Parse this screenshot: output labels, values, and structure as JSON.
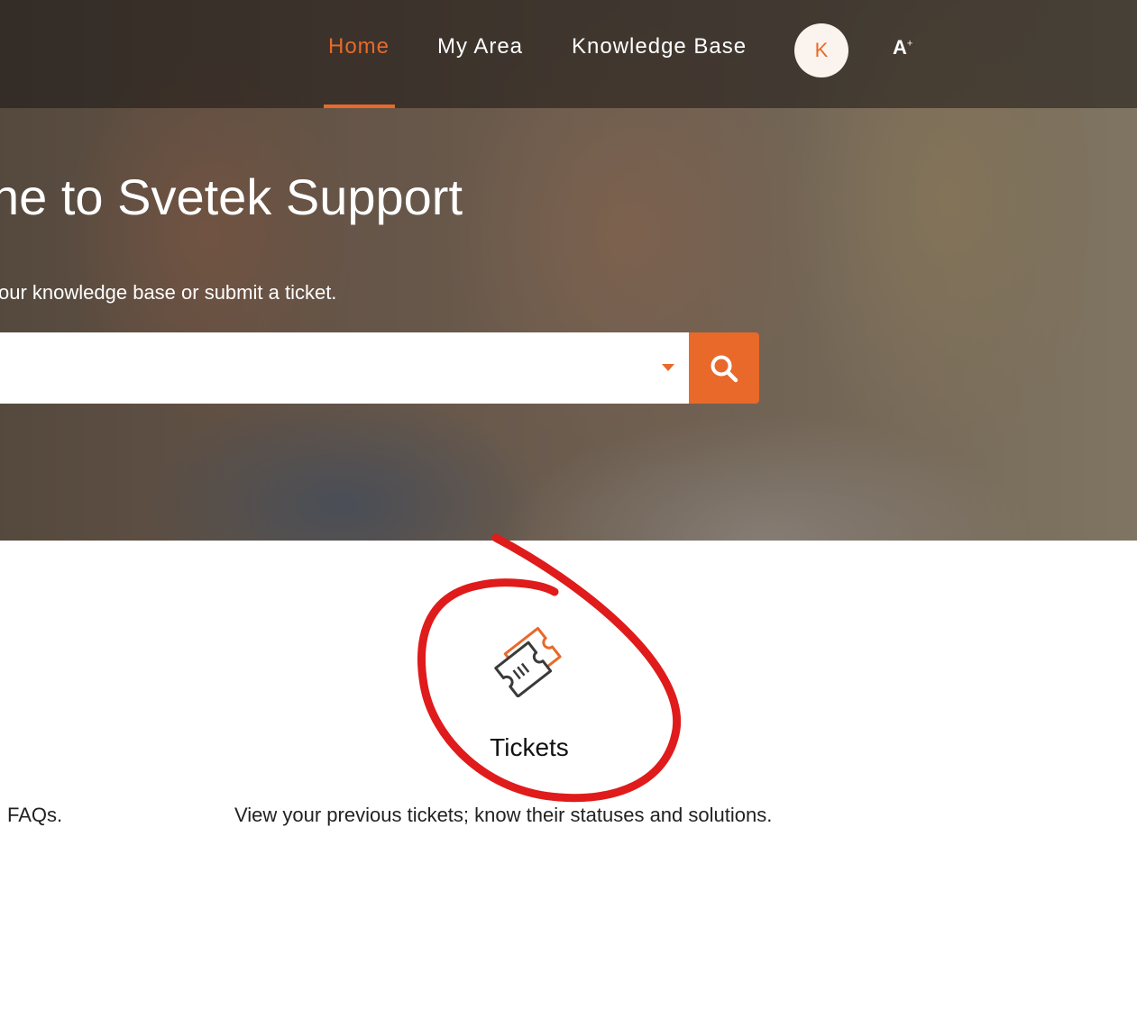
{
  "nav": {
    "items": [
      {
        "label": "Home",
        "active": true
      },
      {
        "label": "My Area",
        "active": false
      },
      {
        "label": "Knowledge Base",
        "active": false
      }
    ],
    "avatar_initial": "K",
    "font_size_label": "A",
    "font_size_sup": "+"
  },
  "hero": {
    "title": "ne to Svetek Support",
    "subtitle": "our knowledge base or submit a ticket.",
    "search_placeholder": ""
  },
  "cards": {
    "faq_description": "FAQs.",
    "tickets_title": "Tickets",
    "tickets_description": "View your previous tickets; know their statuses and solutions."
  },
  "colors": {
    "accent": "#e8692a",
    "annotation": "#e01b1b"
  },
  "icons": {
    "search": "search-icon",
    "tickets": "ticket-icon",
    "dropdown": "caret-down-icon"
  }
}
